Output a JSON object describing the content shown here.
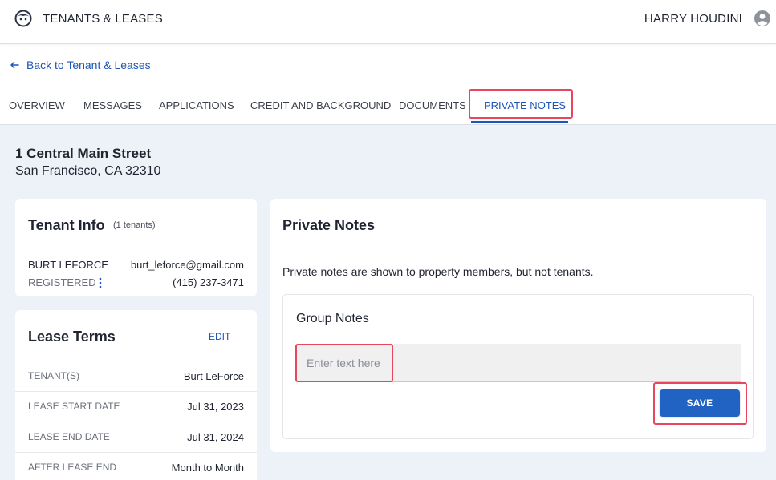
{
  "header": {
    "app_title": "TENANTS & LEASES",
    "logo_icon": "face-logo-icon",
    "user_name": "HARRY HOUDINI",
    "user_icon": "account-circle-icon"
  },
  "nav": {
    "back_label": "Back to Tenant & Leases",
    "back_icon": "arrow-left-icon"
  },
  "tabs": [
    {
      "label": "OVERVIEW"
    },
    {
      "label": "MESSAGES"
    },
    {
      "label": "APPLICATIONS"
    },
    {
      "label": "CREDIT AND BACKGROUND"
    },
    {
      "label": "DOCUMENTS"
    },
    {
      "label": "PRIVATE NOTES",
      "active": true
    }
  ],
  "property": {
    "address_line1": "1 Central Main Street",
    "address_line2": "San Francisco, CA 32310"
  },
  "tenant_info": {
    "title": "Tenant Info",
    "count": "(1 tenants)",
    "tenant": {
      "name": "BURT LEFORCE",
      "email": "burt_leforce@gmail.com",
      "status": "REGISTERED",
      "phone": "(415) 237-3471"
    }
  },
  "lease_terms": {
    "title": "Lease Terms",
    "edit_label": "EDIT",
    "rows": [
      {
        "label": "TENANT(S)",
        "value": "Burt LeForce"
      },
      {
        "label": "LEASE START DATE",
        "value": "Jul 31, 2023"
      },
      {
        "label": "LEASE END DATE",
        "value": "Jul 31, 2024"
      },
      {
        "label": "AFTER LEASE END",
        "value": "Month to Month"
      }
    ]
  },
  "private_notes": {
    "title": "Private Notes",
    "description": "Private notes are shown to property members, but not tenants.",
    "group_title": "Group Notes",
    "input_value": "",
    "input_placeholder": "Enter text here",
    "save_label": "SAVE"
  },
  "colors": {
    "accent": "#1e56b8",
    "button": "#2163c2",
    "highlight": "#e8465d",
    "background": "#edf1f8"
  }
}
